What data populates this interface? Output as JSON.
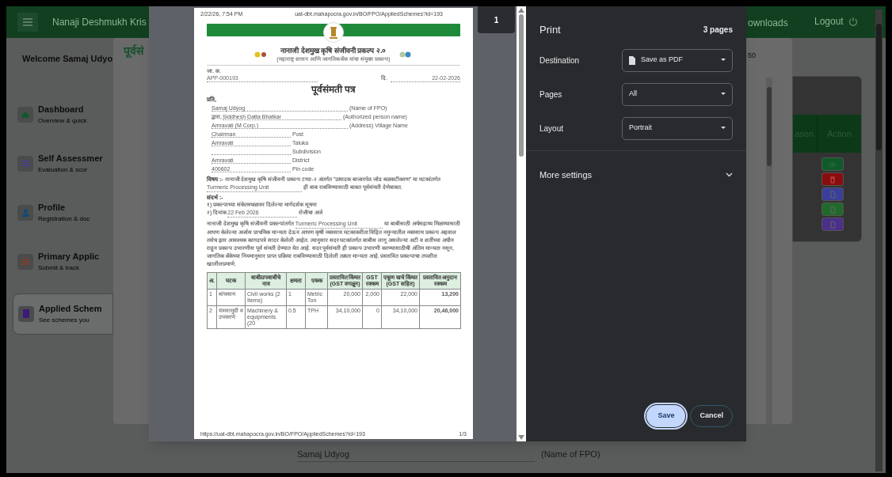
{
  "app": {
    "header": {
      "title": "Nanaji Deshmukh Kris",
      "nav_item": "ownloads",
      "logout": "Logout"
    },
    "welcome": "Welcome Samaj Udyo",
    "sidebar": {
      "items": [
        {
          "kind": "dashboard",
          "title": "Dashboard",
          "subtitle": "Overview & quick",
          "color": "#0f5a2a",
          "selected": false
        },
        {
          "kind": "assessment",
          "title": "Self Assessmer",
          "subtitle": "Evaluation & scor",
          "color": "#4b3f9a",
          "selected": false
        },
        {
          "kind": "profile",
          "title": "Profile",
          "subtitle": "Registration & doc",
          "color": "#0e4a7a",
          "selected": false
        },
        {
          "kind": "application",
          "title": "Primary Applic",
          "subtitle": "Submit & track",
          "color": "#8a3a2a",
          "selected": false
        },
        {
          "kind": "schemes",
          "title": "Applied Schem",
          "subtitle": "See schemes you",
          "color": "#3b1a7a",
          "selected": true
        }
      ]
    },
    "modal": {
      "title": "पूर्वसं",
      "count": "50"
    },
    "table": {
      "columns": [
        "ason",
        "Action"
      ],
      "actions": [
        {
          "kind": "view",
          "color": "#0f5a2a"
        },
        {
          "kind": "delete",
          "color": "#8a0d0d"
        },
        {
          "kind": "document",
          "color": "#3a3f9a"
        },
        {
          "kind": "document",
          "color": "#1f6a2a"
        },
        {
          "kind": "document",
          "color": "#4b2f8a"
        }
      ]
    },
    "lines": [
      {
        "value": "Samaj Udyog",
        "label": "(Name of FPO)"
      }
    ]
  },
  "print_preview": {
    "thumbnail_page": "1",
    "page_header": {
      "datetime": "2/22/26, 7:54 PM",
      "url": "uat-dbt.mahapocra.gov.in/BO/FPO/AppliedSchemes?id=193"
    },
    "document": {
      "project_title": "नानाजी देशमुख कृषि संजीवनी प्रकल्प २.०",
      "project_subtitle": "(महाराष्ट्र शासन आणि जागतिक बँक यांचा संयुक्त प्रकल्प)",
      "ref_label": "जा. क्र.",
      "ref_no": "APP-000193",
      "date_label": "दि.",
      "date": "22-02-2026",
      "title": "पूर्वसंमती पत्र",
      "to": "प्रति,",
      "fields": [
        {
          "value": "Samaj Udyog",
          "label": "(Name of FPO)",
          "kind": "wide"
        },
        {
          "prefix": "द्वारा,",
          "value": "Siddhesh Datta Bhatkar",
          "label": "(Authorized person name)",
          "kind": "wide"
        },
        {
          "value": "Amravati (M Corp.)",
          "label": "(Address) Village Name",
          "kind": "wide"
        },
        {
          "value": "Chairman",
          "label": "Post",
          "kind": "short"
        },
        {
          "value": "Amravati",
          "label": "Taluka",
          "kind": "short"
        },
        {
          "label": "Subdivision",
          "kind": "short"
        },
        {
          "value": "Amravati",
          "label": "District",
          "kind": "short"
        },
        {
          "value": "400602",
          "label": "Pin code",
          "kind": "short"
        }
      ],
      "subject": "**विषय :-** नानाजी देशमुख कृषि संजीवनी प्रकल्प टप्पा-२ अंतर्गत \"उत्पादक बाजारपेठ जोड बळकटीकरण\" या घटकांतर्गत",
      "subject_item": "Turmeric Processing Unit",
      "subject_end": "ही बाब राबविण्यासाठी बाबत पूर्वसंमती देणेबाबत.",
      "reference_label": "संदर्भ :-",
      "reference_1": "१) प्रकल्पाच्या संकेतस्थळावर दिलेल्या मार्गदर्शक सूचना",
      "reference_2_label": "२) दिनांक",
      "reference_2_date": "22 Feb 2026",
      "reference_2_end": "रोजीचा अर्ज",
      "body_start": "नानाजी देशमुख कृषि संजीवनी प्रकल्पांतर्गत",
      "body_item": "Turmeric Processing Unit",
      "body": "या बाबीसाठी अर्थसहाय्य मिळण्यासाठी आपण केलेल्या अर्जास प्राथमिक मान्यता देऊन आपण कृषी व्यवसाय घटकाकरीता विहित नमुन्यातील व्यवसाय प्रकल्प अहवाल तसेच इतर आवश्यक कागदपत्रे सादर केलेली आहेत. त्यानुसार सदर घटकांतर्गत बाबीस लागू असलेल्या अटी व शर्तीच्या अधीन राहून प्रकल्प उभारणीस पूर्व संमती देण्यात येत आहे. सदर पूर्वसंमती ही प्रकल्प उभारणी करण्यासाठीची अंतिम मान्यता नसून, जागतिक बँकेच्या नियमानुसार प्राप्त प्रक्रिया राबविण्यासाठी दिलेली तत्वतः मान्यता आहे. प्रस्तावित प्रकल्पाचा तपशील खालीलप्रमाणे.",
      "table": {
        "columns": [
          "अ.",
          "घटक",
          "बाबी/उपबाबीचे नाव",
          "क्षमता",
          "एकक",
          "प्रस्तावित किंमत (GST वगळून)",
          "GST रक्कम",
          "एकूण खर्च किंमत (GST सहित)",
          "प्रस्तावित अनुदान रक्कम"
        ],
        "rows": [
          [
            "1",
            "बांधकाम",
            "Civil works (2 Items)",
            "1",
            "Metric Ton",
            "20,000",
            "2,000",
            "22,000",
            "13,200"
          ],
          [
            "2",
            "यंत्रसामुग्री व उपकरणे",
            "Machinery & equipments (20",
            "0.5",
            "TPH",
            "34,10,000",
            "0",
            "34,10,000",
            "20,46,000"
          ]
        ]
      }
    },
    "page_footer": {
      "url": "https://uat-dbt.mahapocra.gov.in/BO/FPO/AppliedSchemes?id=193",
      "page": "1/3"
    }
  },
  "print_settings": {
    "title": "Print",
    "page_count": "3 pages",
    "fields": [
      {
        "kind": "destination",
        "label": "Destination",
        "value": "Save as PDF"
      },
      {
        "kind": "plain",
        "label": "Pages",
        "value": "All"
      },
      {
        "kind": "plain",
        "label": "Layout",
        "value": "Portrait"
      }
    ],
    "more_settings": {
      "label": "More settings",
      "expanded": false
    },
    "buttons": [
      {
        "kind": "primary",
        "label": "Save"
      },
      {
        "kind": "secondary",
        "label": "Cancel"
      }
    ]
  }
}
